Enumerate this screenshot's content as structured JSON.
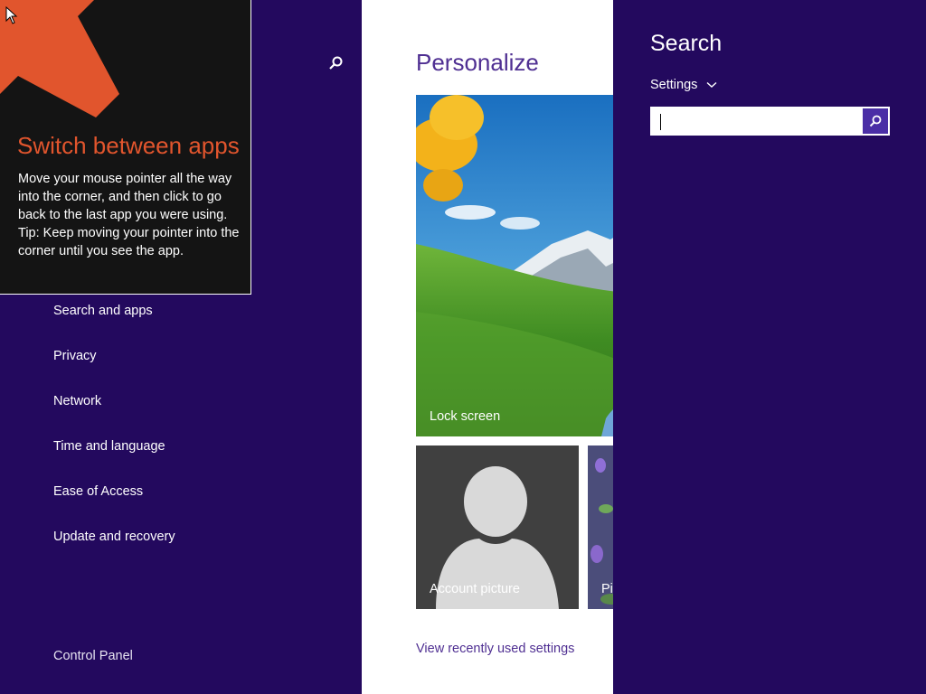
{
  "tip": {
    "title": "Switch between apps",
    "lines": [
      "Move your mouse pointer all the way into the corner, and then click to go back to the last app you were using.",
      "Tip: Keep moving your pointer into the corner until you see the app."
    ],
    "arrow_color": "#e1552d"
  },
  "sidebar": {
    "items": [
      {
        "label": "Search and apps"
      },
      {
        "label": "Privacy"
      },
      {
        "label": "Network"
      },
      {
        "label": "Time and language"
      },
      {
        "label": "Ease of Access"
      },
      {
        "label": "Update and recovery"
      }
    ],
    "footer_link": "Control Panel",
    "search_icon": "search-icon"
  },
  "content": {
    "title": "Personalize",
    "tiles": {
      "lock_screen": "Lock screen",
      "account_picture": "Account picture",
      "picture_password": "Pi"
    },
    "recent_link": "View recently used settings"
  },
  "search_charm": {
    "heading": "Search",
    "scope": "Settings",
    "scope_icon": "chevron-down-icon",
    "input_value": "",
    "go_icon": "search-icon"
  },
  "colors": {
    "accent": "#23095e",
    "title_purple": "#4f2f92",
    "tip_orange": "#e1552d",
    "search_button": "#4a2ea6"
  }
}
